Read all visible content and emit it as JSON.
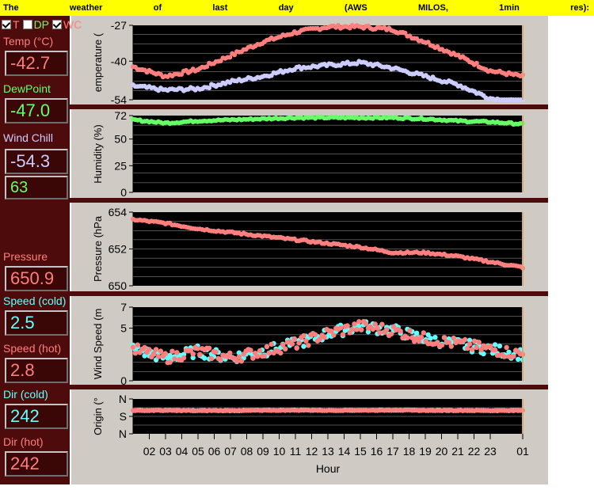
{
  "title_words": [
    "The",
    "weather",
    "of",
    "last",
    "day",
    "(AWS",
    "MILOS,",
    "1min",
    "res):"
  ],
  "checkboxes": [
    {
      "label": "T",
      "checked": true,
      "color": "#ff7f7f"
    },
    {
      "label": "DP",
      "checked": false,
      "color": "#66ff66"
    },
    {
      "label": "WC",
      "checked": true,
      "color": "#ff7f7f"
    }
  ],
  "readouts": {
    "temp": {
      "label": "Temp (°C)",
      "value": "-42.7"
    },
    "dewpoint": {
      "label": "DewPoint",
      "value": "-47.0"
    },
    "windchill": {
      "label": "Wind Chill",
      "value": "-54.3"
    },
    "humidity": {
      "value": "63"
    },
    "pressure": {
      "label": "Pressure",
      "value": "650.9"
    },
    "speed_cold": {
      "label": "Speed (cold)",
      "value": "2.5"
    },
    "speed_hot": {
      "label": "Speed (hot)",
      "value": "2.8"
    },
    "dir_cold": {
      "label": "Dir (cold)",
      "value": "242"
    },
    "dir_hot": {
      "label": "Dir (hot)",
      "value": "242"
    }
  },
  "colors": {
    "temp": "#ff7f7f",
    "dewpoint": "#66ff66",
    "windchill": "#ccccff",
    "humidity": "#66ff66",
    "pressure": "#ff7f7f",
    "speed_cold": "#66ffff",
    "speed_hot": "#ff7f7f",
    "dir_cold": "#66ffff",
    "dir_hot": "#ff7f7f",
    "plot_bg": "#000000",
    "gridline": "#a0a0a0",
    "frame": "#4d0b0b",
    "title_bg": "#ffff00"
  },
  "chart_data": [
    {
      "type": "scatter",
      "ylabel": "emperature (",
      "ylim": [
        -54,
        -27
      ],
      "yticks": [
        -27,
        -40,
        -54
      ],
      "x_hours": [
        1,
        3,
        5,
        7,
        9,
        11,
        13,
        15,
        17,
        19,
        21,
        23,
        25
      ],
      "series": [
        {
          "name": "T",
          "values": [
            -42,
            -45.5,
            -43,
            -38,
            -33,
            -29.5,
            -27.5,
            -27.5,
            -28.5,
            -33,
            -38,
            -43.5,
            -45.5
          ]
        },
        {
          "name": "WC",
          "values": [
            -49,
            -50.5,
            -50,
            -47.5,
            -45.5,
            -42.5,
            -41.5,
            -40.5,
            -42.5,
            -45.5,
            -48.5,
            -53.5,
            -55
          ]
        }
      ]
    },
    {
      "type": "scatter",
      "ylabel": "Humidity (%)",
      "ylim": [
        0,
        72
      ],
      "yticks": [
        0,
        25,
        50,
        72
      ],
      "x_hours": [
        1,
        3,
        5,
        7,
        9,
        11,
        13,
        15,
        17,
        19,
        21,
        23,
        25
      ],
      "series": [
        {
          "name": "RH",
          "values": [
            68,
            65,
            67,
            68,
            69,
            70,
            70,
            70,
            70,
            69,
            67,
            66,
            64
          ]
        }
      ]
    },
    {
      "type": "scatter",
      "ylabel": "Pressure (hPa",
      "ylim": [
        650,
        654
      ],
      "yticks": [
        650,
        652,
        654
      ],
      "x_hours": [
        1,
        3,
        5,
        7,
        9,
        11,
        13,
        15,
        17,
        19,
        21,
        23,
        25
      ],
      "series": [
        {
          "name": "P",
          "values": [
            653.6,
            653.4,
            653.1,
            652.9,
            652.7,
            652.5,
            652.3,
            652.1,
            651.8,
            651.8,
            651.6,
            651.3,
            651.0
          ]
        }
      ]
    },
    {
      "type": "scatter",
      "ylabel": "Wind Speed (m",
      "ylim": [
        0,
        7
      ],
      "yticks": [
        0,
        5,
        7
      ],
      "x_hours": [
        1,
        3,
        5,
        7,
        9,
        11,
        13,
        15,
        17,
        19,
        21,
        23,
        25
      ],
      "series": [
        {
          "name": "cold",
          "values": [
            3.0,
            2.2,
            2.8,
            2.2,
            2.8,
            3.5,
            4.5,
            5.2,
            4.8,
            4.0,
            3.5,
            3.0,
            2.5
          ]
        },
        {
          "name": "hot",
          "values": [
            3.0,
            2.2,
            2.8,
            2.2,
            2.8,
            3.5,
            4.5,
            5.2,
            4.8,
            4.0,
            3.5,
            3.0,
            2.5
          ]
        }
      ]
    },
    {
      "type": "scatter",
      "ylabel": "Origin (°",
      "ylim": [
        0,
        360
      ],
      "yticks_labels": [
        "N",
        "S",
        "N"
      ],
      "yticks": [
        360,
        180,
        0
      ],
      "x_hours": [
        1,
        3,
        5,
        7,
        9,
        11,
        13,
        15,
        17,
        19,
        21,
        23,
        25
      ],
      "series": [
        {
          "name": "cold",
          "values": [
            242,
            242,
            240,
            240,
            242,
            245,
            242,
            243,
            245,
            242,
            242,
            240,
            242
          ]
        },
        {
          "name": "hot",
          "values": [
            242,
            242,
            240,
            240,
            242,
            245,
            242,
            243,
            245,
            242,
            242,
            240,
            242
          ]
        }
      ]
    }
  ],
  "x_axis": {
    "title": "Hour",
    "tick_labels": [
      "02",
      "03",
      "04",
      "05",
      "06",
      "07",
      "08",
      "09",
      "10",
      "11",
      "12",
      "13",
      "14",
      "15",
      "16",
      "17",
      "18",
      "19",
      "20",
      "21",
      "22",
      "23",
      "01"
    ]
  }
}
